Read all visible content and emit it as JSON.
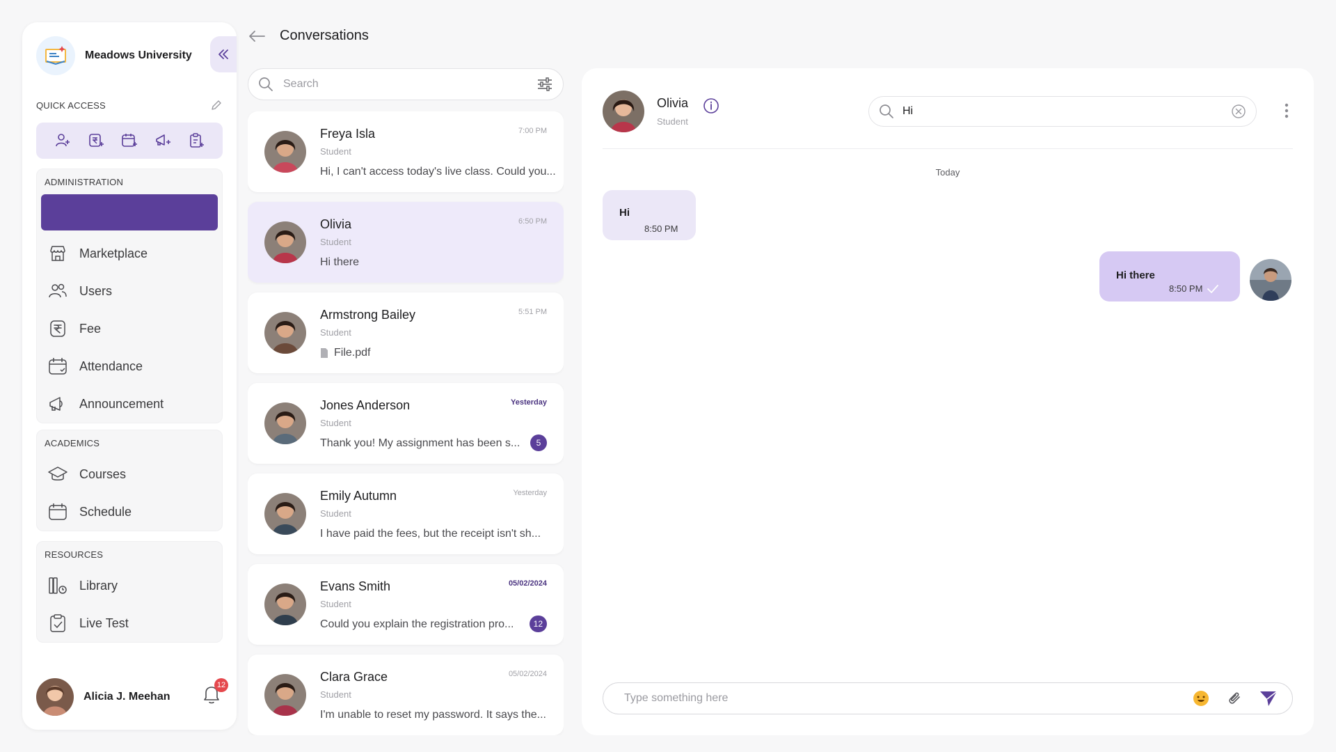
{
  "app": {
    "brand_name": "Meadows University"
  },
  "quick_access": {
    "title": "QUICK ACCESS",
    "icons": [
      "add-user-icon",
      "add-fee-icon",
      "add-attendance-icon",
      "add-announcement-icon",
      "add-test-icon"
    ]
  },
  "sidebar": {
    "administration": {
      "title": "ADMINISTRATION",
      "items": [
        {
          "label": "Marketplace",
          "icon": "store-icon"
        },
        {
          "label": "Users",
          "icon": "users-icon"
        },
        {
          "label": "Fee",
          "icon": "rupee-icon"
        },
        {
          "label": "Attendance",
          "icon": "calendar-check-icon"
        },
        {
          "label": "Announcement",
          "icon": "megaphone-icon"
        }
      ]
    },
    "academics": {
      "title": "ACADEMICS",
      "items": [
        {
          "label": "Courses",
          "icon": "graduation-cap-icon"
        },
        {
          "label": "Schedule",
          "icon": "calendar-icon"
        }
      ]
    },
    "resources": {
      "title": "RESOURCES",
      "items": [
        {
          "label": "Library",
          "icon": "books-icon"
        },
        {
          "label": "Live Test",
          "icon": "clipboard-check-icon"
        }
      ]
    }
  },
  "user": {
    "name": "Alicia J. Meehan",
    "notifications": "12"
  },
  "conversations": {
    "title": "Conversations",
    "search_placeholder": "Search",
    "list": [
      {
        "name": "Freya Isla",
        "role": "Student",
        "message": "Hi, I can't access today's live class. Could you...",
        "time": "7:00 PM",
        "unread": "",
        "active": false,
        "time_bold": false,
        "avatar": "#c9485b"
      },
      {
        "name": "Olivia",
        "role": "Student",
        "message": "Hi there",
        "time": "6:50 PM",
        "unread": "",
        "active": true,
        "time_bold": false,
        "avatar": "#b8364a"
      },
      {
        "name": "Armstrong Bailey",
        "role": "Student",
        "message": "File.pdf",
        "time": "5:51 PM",
        "unread": "",
        "active": false,
        "time_bold": false,
        "attachment": true,
        "avatar": "#6b4a3a"
      },
      {
        "name": "Jones Anderson",
        "role": "Student",
        "message": "Thank you! My assignment has been s...",
        "time": "Yesterday",
        "unread": "5",
        "active": false,
        "time_bold": true,
        "avatar": "#5a6b7a"
      },
      {
        "name": "Emily Autumn",
        "role": "Student",
        "message": "I have paid the fees, but the receipt isn't sh...",
        "time": "Yesterday",
        "unread": "",
        "active": false,
        "time_bold": false,
        "avatar": "#3a4a5a"
      },
      {
        "name": "Evans Smith",
        "role": "Student",
        "message": "Could you explain the registration pro...",
        "time": "05/02/2024",
        "unread": "12",
        "active": false,
        "time_bold": true,
        "avatar": "#2f3e4d"
      },
      {
        "name": "Clara Grace",
        "role": "Student",
        "message": "I'm unable to reset my password. It says the...",
        "time": "05/02/2024",
        "unread": "",
        "active": false,
        "time_bold": false,
        "avatar": "#a8334a"
      }
    ]
  },
  "chat": {
    "contact_name": "Olivia",
    "contact_role": "Student",
    "search_value": "Hi",
    "day_label": "Today",
    "incoming": {
      "text": "Hi",
      "time": "8:50 PM"
    },
    "outgoing": {
      "text": "Hi there",
      "time": "8:50 PM"
    },
    "composer_placeholder": "Type something here"
  },
  "colors": {
    "accent": "#5b3f9a",
    "accent_light": "#ebe7f7",
    "bubble_out": "#d6c9f3",
    "badge_red": "#e5484d"
  }
}
